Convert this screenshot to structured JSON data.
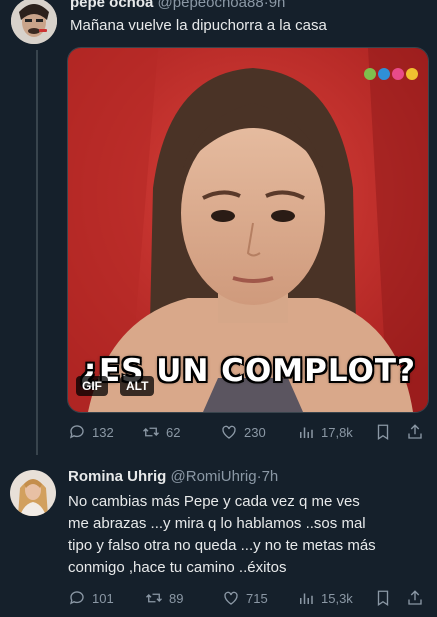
{
  "tweet1": {
    "name": "pepe ochoa",
    "handle": "@pepeochoa88",
    "time": "9h",
    "text": "Mañana vuelve la dipuchorra a la casa",
    "media": {
      "caption": "¿ES UN COMPLOT?",
      "gif_badge": "GIF",
      "alt_badge": "ALT"
    },
    "actions": {
      "replies": "132",
      "retweets": "62",
      "likes": "230",
      "views": "17,8k"
    }
  },
  "tweet2": {
    "name": "Romina Uhrig",
    "handle": "@RomiUhrig",
    "time": "7h",
    "lines": [
      "No cambias más Pepe  y cada vez q me ves",
      "me abrazas ...y mira q lo hablamos ..sos mal",
      "tipo y falso otra no queda ...y no te metas más",
      "conmigo ,hace tu camino ..éxitos"
    ],
    "actions": {
      "replies": "101",
      "retweets": "89",
      "likes": "715",
      "views": "15,3k"
    }
  },
  "icons": {
    "reply": "speech-bubble",
    "retweet": "retweet-arrows",
    "like": "heart-outline",
    "views": "bar-chart",
    "bookmark": "bookmark-outline",
    "share": "share-arrow"
  },
  "colors": {
    "background": "#15202b",
    "muted": "#8b98a5",
    "text": "#e7e9ea",
    "border": "#38444d"
  }
}
